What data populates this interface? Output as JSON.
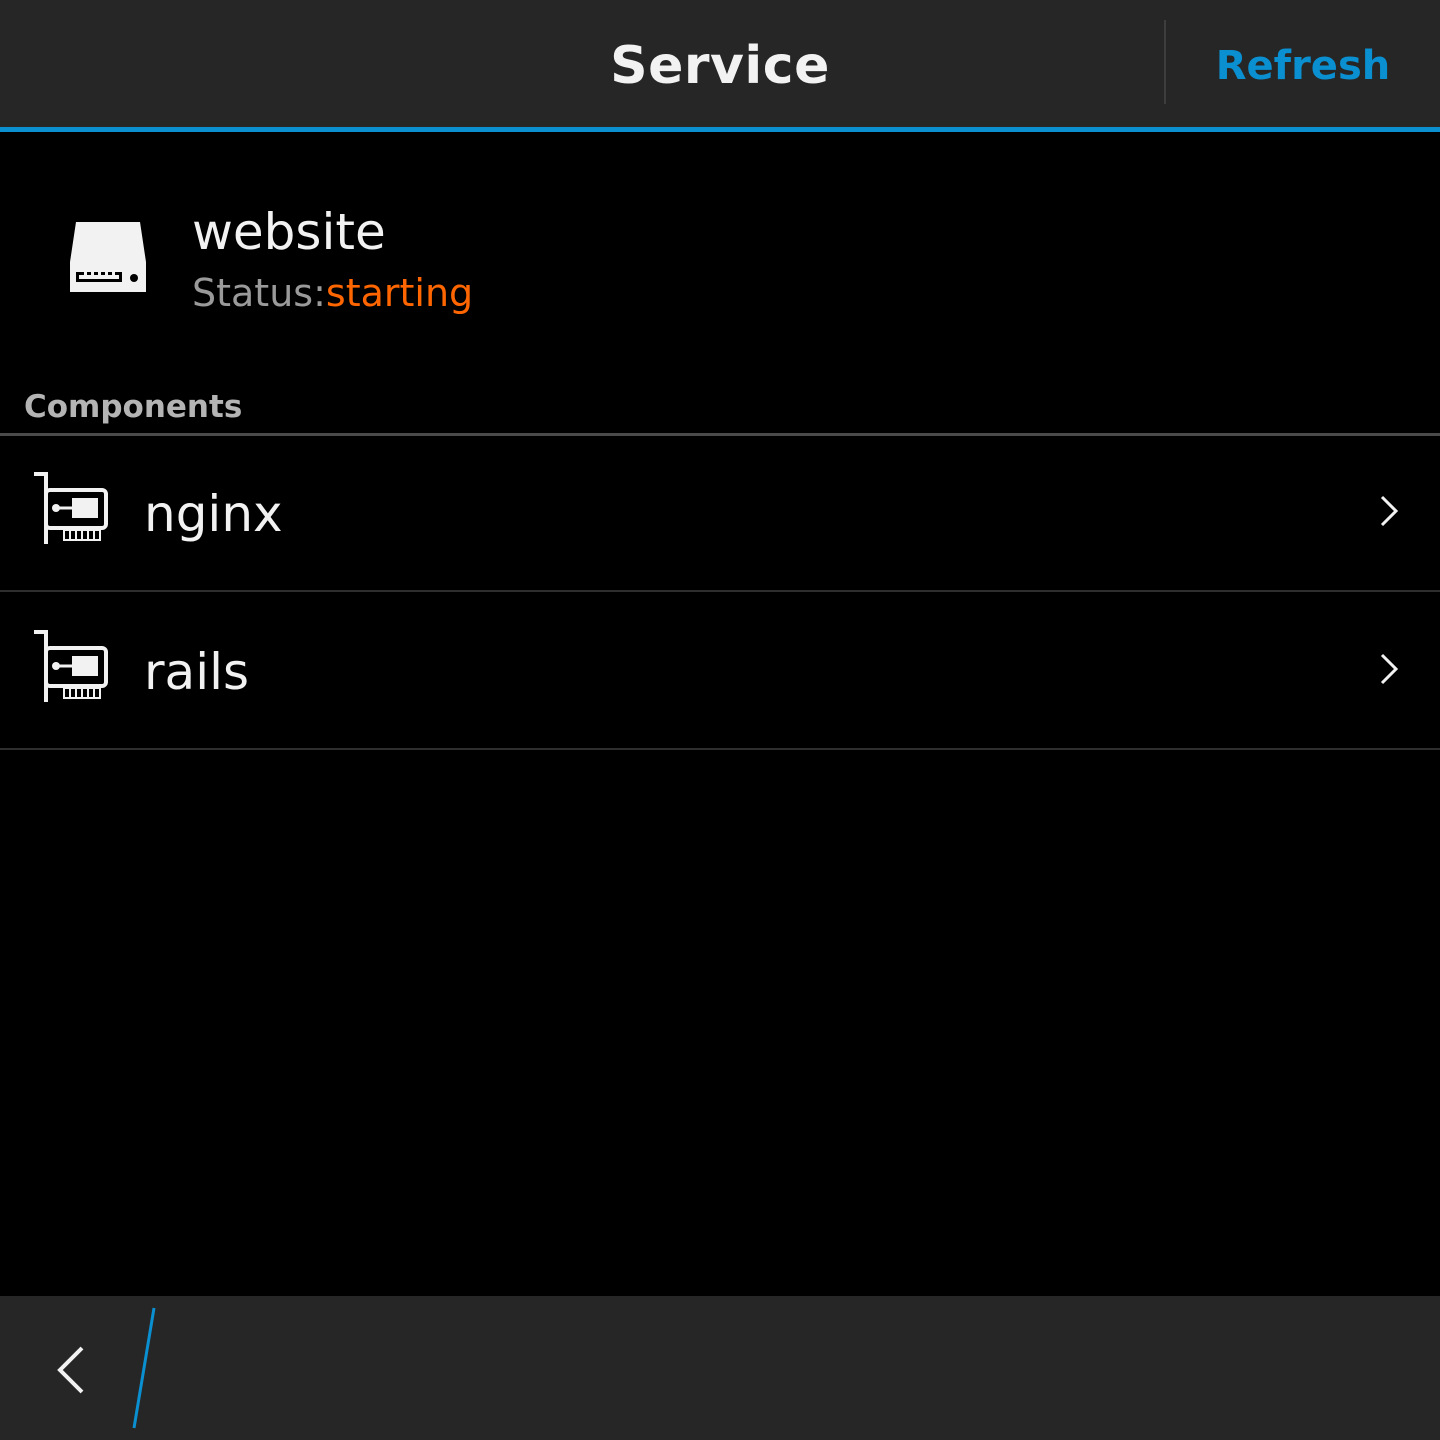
{
  "titlebar": {
    "title": "Service",
    "refresh_label": "Refresh"
  },
  "service": {
    "name": "website",
    "status_label": "Status:",
    "status_value": "starting",
    "icon": "server-icon"
  },
  "components": {
    "header": "Components",
    "items": [
      {
        "label": "nginx",
        "icon": "component-card-icon"
      },
      {
        "label": "rails",
        "icon": "component-card-icon"
      }
    ]
  },
  "actionbar": {
    "back_icon": "back-arrow-icon"
  },
  "colors": {
    "accent": "#0a8fd1",
    "status_starting": "#ff6600",
    "bar_background": "#262626",
    "background": "#000000"
  }
}
